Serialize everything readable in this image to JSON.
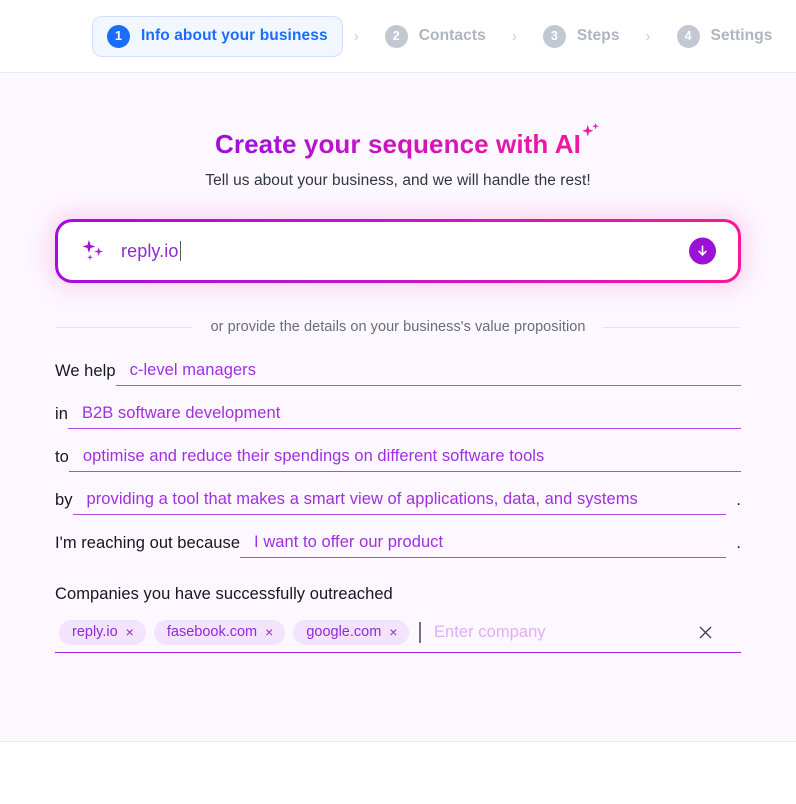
{
  "stepper": {
    "separator": "›",
    "steps": [
      {
        "number": "1",
        "label": "Info about your business",
        "state": "active"
      },
      {
        "number": "2",
        "label": "Contacts",
        "state": "inactive"
      },
      {
        "number": "3",
        "label": "Steps",
        "state": "inactive"
      },
      {
        "number": "4",
        "label": "Settings",
        "state": "inactive"
      }
    ]
  },
  "hero": {
    "title": "Create your sequence with AI",
    "subtitle": "Tell us about your business, and we will handle the rest!",
    "title_gradient_from": "#9b0ee0",
    "title_gradient_to": "#f0189f"
  },
  "ai_prompt": {
    "value": "reply.io",
    "icon": "sparkles-icon",
    "submit_icon": "arrow-down-icon",
    "accent_from": "#a50bdf",
    "accent_to": "#f7179a",
    "submit_color": "#9b12d6"
  },
  "divider": {
    "text": "or provide the details on your business's value proposition"
  },
  "form": {
    "rows": [
      {
        "prefix": "We help",
        "value": "c-level managers",
        "period": ""
      },
      {
        "prefix": "in",
        "value": "B2B software development",
        "period": ""
      },
      {
        "prefix": "to",
        "value": "optimise and reduce their spendings on different software tools",
        "period": ""
      },
      {
        "prefix": "by",
        "value": "providing a tool that makes a smart view of applications, data, and systems",
        "period": "."
      },
      {
        "prefix": "I'm reaching out because",
        "value": "I want to offer our product",
        "period": "."
      }
    ],
    "input_color": "#a12fe0",
    "underline_color": "#b44be0"
  },
  "companies": {
    "label": "Companies you have successfully outreached",
    "chips": [
      {
        "name": "reply.io",
        "remove": "×"
      },
      {
        "name": "fasebook.com",
        "remove": "×"
      },
      {
        "name": "google.com",
        "remove": "×"
      }
    ],
    "placeholder": "Enter company",
    "clear_icon": "close-icon",
    "chip_bg": "#f3e3fd",
    "chip_color": "#8f2ad6"
  }
}
